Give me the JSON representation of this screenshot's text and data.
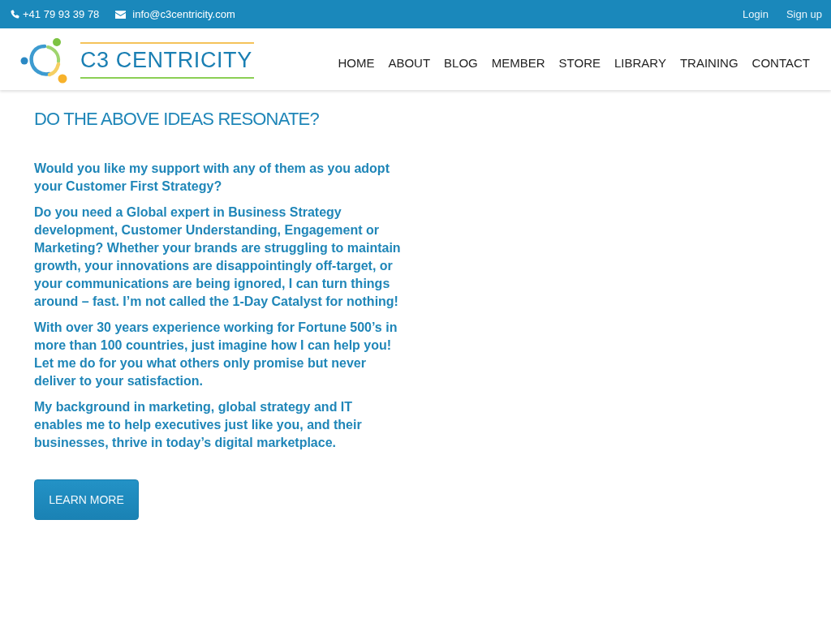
{
  "top_bar": {
    "phone": "+41 79 93 39 78",
    "email": "info@c3centricity.com",
    "links": [
      "Login",
      "Sign up"
    ]
  },
  "header": {
    "logo_text": "C3 CENTRICITY",
    "nav": [
      "HOME",
      "ABOUT",
      "BLOG",
      "MEMBER",
      "STORE",
      "LIBRARY",
      "TRAINING",
      "CONTACT"
    ]
  },
  "main": {
    "heading": "DO THE ABOVE IDEAS RESONATE?",
    "paragraphs": [
      "Would you like my support with any of them as you adopt your Customer First Strategy?",
      "Do you need a Global expert in Business Strategy development, Customer Understanding, Engagement or Marketing? Whether your brands are struggling to maintain growth, your innovations are disappointingly off-target, or your communications are being ignored, I can turn things around – fast. I’m not called the 1-Day Catalyst for nothing!",
      "With over 30 years experience working for Fortune 500’s in more than 100 countries, just imagine how I can help you! Let me do for you what others only promise but never deliver to your satisfaction.",
      "My background in marketing, global strategy and IT enables me to help executives just like you, and their businesses, thrive in today’s digital marketplace."
    ],
    "button": "LEARN MORE"
  }
}
